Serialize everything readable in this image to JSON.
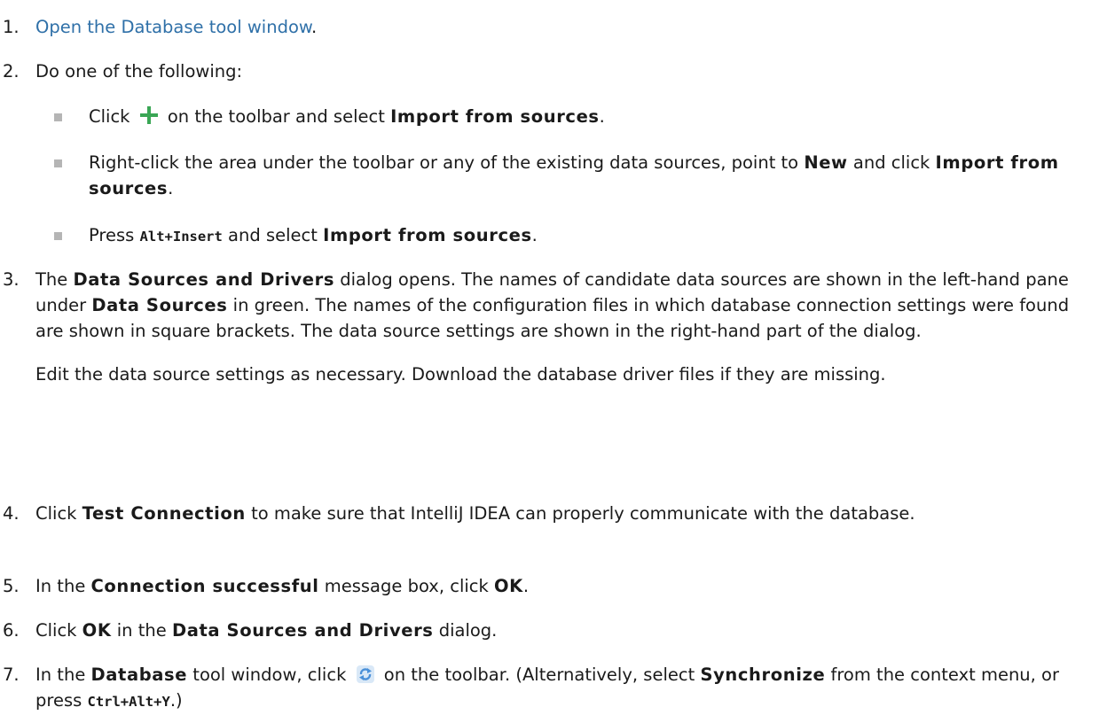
{
  "steps": [
    {
      "number": "1.",
      "link": "Open the Database tool window",
      "after": "."
    },
    {
      "number": "2.",
      "text": "Do one of the following:"
    },
    {
      "number": "3.",
      "text_a": "The ",
      "bold_a": "Data Sources and Drivers",
      "text_b": " dialog opens. The names of candidate data sources are shown in the left-hand pane under ",
      "bold_b": "Data Sources",
      "text_c": " in green. The names of the configuration files in which database connection settings were found are shown in square brackets. The data source settings are shown in the right-hand part of the dialog.",
      "para2": "Edit the data source settings as necessary. Download the database driver files if they are missing."
    },
    {
      "number": "4.",
      "text_a": "Click ",
      "bold_a": "Test Connection",
      "text_b": " to make sure that IntelliJ IDEA can properly communicate with the database."
    },
    {
      "number": "5.",
      "text_a": "In the ",
      "bold_a": "Connection successful",
      "text_b": " message box, click ",
      "bold_b": "OK",
      "text_c": "."
    },
    {
      "number": "6.",
      "text_a": "Click ",
      "bold_a": "OK",
      "text_b": " in the ",
      "bold_b": "Data Sources and Drivers",
      "text_c": " dialog."
    },
    {
      "number": "7.",
      "text_a": "In the ",
      "bold_a": "Database",
      "text_b": " tool window, click ",
      "text_c": " on the toolbar. (Alternatively, select ",
      "bold_b": "Synchronize",
      "text_d": " from the context menu, or press ",
      "code": "Ctrl+Alt+Y",
      "text_e": ".)"
    }
  ],
  "substeps": [
    {
      "text_a": "Click ",
      "text_b": " on the toolbar and select ",
      "bold_a": "Import from sources",
      "text_c": "."
    },
    {
      "text_a": "Right-click the area under the toolbar or any of the existing data sources, point to ",
      "bold_a": "New",
      "text_b": " and click ",
      "bold_b": "Import from sources",
      "text_c": "."
    },
    {
      "text_a": "Press ",
      "code": "Alt+Insert",
      "text_b": " and select ",
      "bold_a": "Import from sources",
      "text_c": "."
    }
  ],
  "icons": {
    "add": "plus-icon",
    "synchronize": "synchronize-icon",
    "add_color": "#3aa655",
    "sync_color": "#4a90d9",
    "link_color": "#2f70a8",
    "bullet_color": "#b5b5b5"
  }
}
